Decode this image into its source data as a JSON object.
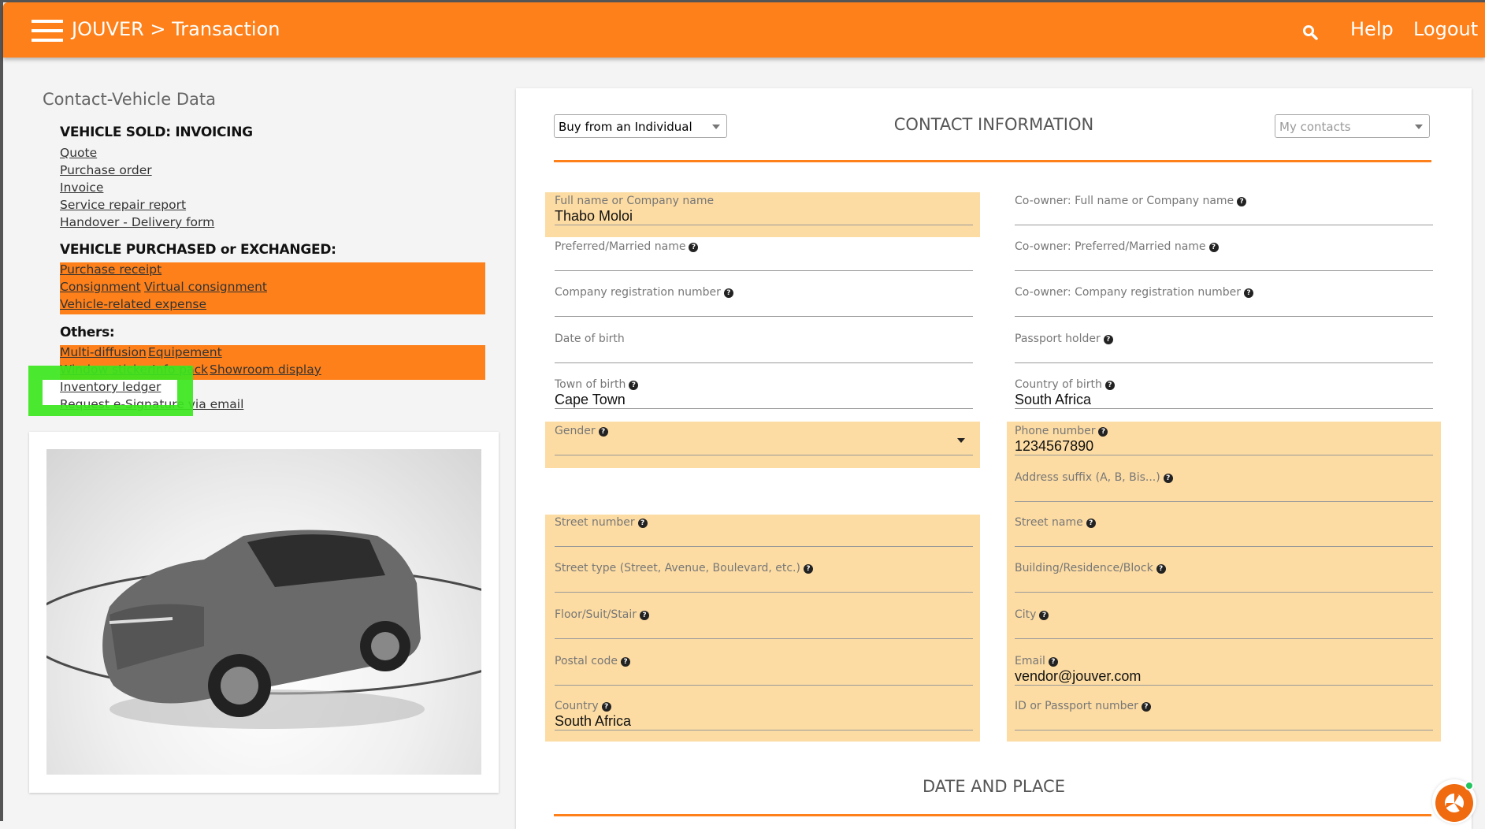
{
  "header": {
    "app": "JOUVER > Transaction",
    "help": "Help",
    "logout": "Logout"
  },
  "left": {
    "title": "Contact-Vehicle Data",
    "sold_heading": "VEHICLE SOLD: INVOICING",
    "sold_links": [
      "Quote",
      "Purchase order",
      "Invoice",
      "Service repair report",
      "Handover - Delivery form"
    ],
    "purchased_heading": "VEHICLE PURCHASED or EXCHANGED:",
    "purchased_links": [
      "Purchase receipt",
      "Consignment",
      "Virtual consignment",
      "Vehicle-related expense"
    ],
    "others_heading": "Others:",
    "others_links": [
      "Multi-diffusion",
      "Equipement",
      "Window sticker",
      "Info pack",
      "Showroom display",
      "Inventory ledger",
      "Request e-Signature via email"
    ]
  },
  "form": {
    "transaction_type": "Buy from an Individual",
    "title": "CONTACT INFORMATION",
    "contacts_placeholder": "My contacts",
    "left_fields": [
      {
        "label": "Full name or Company name",
        "value": "Thabo Moloi",
        "help": false
      },
      {
        "label": "Preferred/Married name",
        "value": "",
        "help": true
      },
      {
        "label": "Company registration number",
        "value": "",
        "help": true
      },
      {
        "label": "Date of birth",
        "value": "",
        "help": false
      },
      {
        "label": "Town of birth",
        "value": "Cape Town",
        "help": true
      },
      {
        "label": "Gender",
        "value": "",
        "help": true,
        "select": true
      },
      {
        "label": "Street number",
        "value": "",
        "help": true
      },
      {
        "label": "Street type (Street, Avenue, Boulevard, etc.)",
        "value": "",
        "help": true
      },
      {
        "label": "Floor/Suit/Stair",
        "value": "",
        "help": true
      },
      {
        "label": "Postal code",
        "value": "",
        "help": true
      },
      {
        "label": "Country",
        "value": "South Africa",
        "help": true
      }
    ],
    "right_fields": [
      {
        "label": "Co-owner: Full name or Company name",
        "value": "",
        "help": true
      },
      {
        "label": "Co-owner: Preferred/Married name",
        "value": "",
        "help": true
      },
      {
        "label": "Co-owner: Company registration number",
        "value": "",
        "help": true
      },
      {
        "label": "Passport holder",
        "value": "",
        "help": true
      },
      {
        "label": "Country of birth",
        "value": "South Africa",
        "help": true
      },
      {
        "label": "Phone number",
        "value": "1234567890",
        "help": true
      },
      {
        "label": "Address suffix (A, B, Bis...)",
        "value": "",
        "help": true
      },
      {
        "label": "Street name",
        "value": "",
        "help": true
      },
      {
        "label": "Building/Residence/Block",
        "value": "",
        "help": true
      },
      {
        "label": "City",
        "value": "",
        "help": true
      },
      {
        "label": "Email",
        "value": "vendor@jouver.com",
        "help": true
      },
      {
        "label": "ID or Passport number",
        "value": "",
        "help": true
      }
    ],
    "section2_title": "DATE AND PLACE"
  },
  "colors": {
    "accent": "#fe801a",
    "highlight": "#fddca3",
    "focus": "#3ce61e"
  }
}
